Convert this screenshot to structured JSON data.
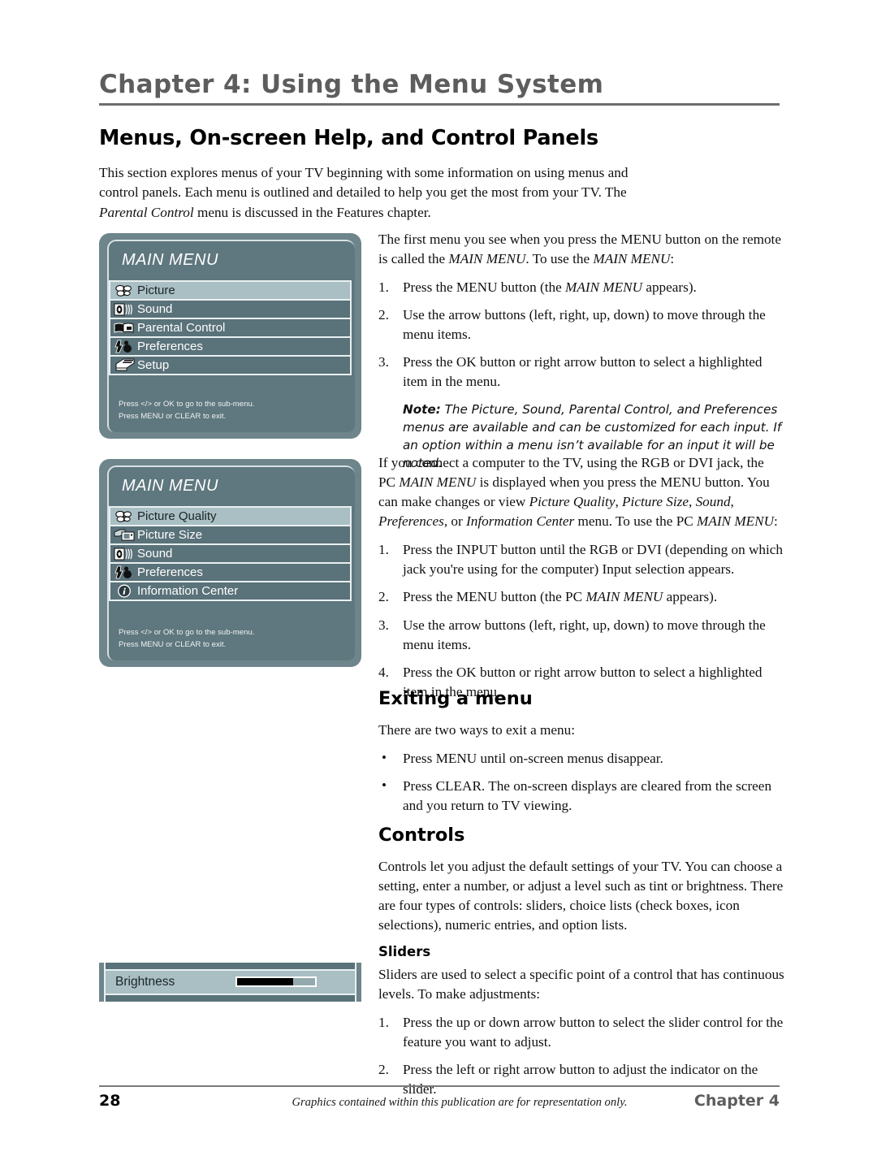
{
  "header": {
    "chapter_title": "Chapter 4: Using the Menu System",
    "main_heading": "Menus, On-screen Help, and Control Panels"
  },
  "intro": {
    "line_a": "This section explores menus of your TV beginning with some information on using menus and control panels. Each menu is outlined and detailed to help you get the most from your TV. The ",
    "emphasis": "Parental Control",
    "line_b": " menu is discussed in the Features chapter."
  },
  "osd_main_menu": {
    "title": "MAIN MENU",
    "items": [
      {
        "label": "Picture",
        "icon": "butterfly-icon",
        "selected": true
      },
      {
        "label": "Sound",
        "icon": "speaker-icon",
        "selected": false
      },
      {
        "label": "Parental Control",
        "icon": "book-icon",
        "selected": false
      },
      {
        "label": "Preferences",
        "icon": "person-icon",
        "selected": false
      },
      {
        "label": "Setup",
        "icon": "toolbox-icon",
        "selected": false
      }
    ],
    "help_line_1": "Press </> or OK to go to the sub-menu.",
    "help_line_2": "Press MENU or CLEAR to exit."
  },
  "osd_pc_main_menu": {
    "title": "MAIN MENU",
    "items": [
      {
        "label": "Picture Quality",
        "icon": "butterfly-icon",
        "selected": true
      },
      {
        "label": "Picture Size",
        "icon": "screen-size-icon",
        "selected": false
      },
      {
        "label": "Sound",
        "icon": "speaker-icon",
        "selected": false
      },
      {
        "label": "Preferences",
        "icon": "person-icon",
        "selected": false
      },
      {
        "label": "Information Center",
        "icon": "info-icon",
        "selected": false
      }
    ],
    "help_line_1": "Press </> or OK to go to the sub-menu.",
    "help_line_2": "Press MENU or CLEAR to exit."
  },
  "osd_slider_panel": {
    "label": "Brightness",
    "fill_percent": 72
  },
  "section_main_menu": {
    "lead_a": "The first menu you see when you press the MENU button on the remote is called the ",
    "lead_em1": "MAIN MENU",
    "lead_b": ". To use the ",
    "lead_em2": "MAIN MENU",
    "lead_c": ":",
    "steps": [
      {
        "num": "1.",
        "a": "Press the MENU button (the ",
        "em": "MAIN MENU",
        "b": " appears)."
      },
      {
        "num": "2.",
        "a": "Use the arrow buttons (left, right, up, down) to move through the menu items.",
        "em": "",
        "b": ""
      },
      {
        "num": "3.",
        "a": "Press the OK button or right arrow button to select a highlighted item in the menu.",
        "em": "",
        "b": ""
      }
    ],
    "note_label": "Note:",
    "note_text": " The Picture, Sound, Parental Control, and Preferences menus are available and can be customized for each input. If an option within a menu isn’t available for an input it will be noted."
  },
  "section_pc_menu": {
    "lead_a": "If you connect a computer to the TV, using the RGB or DVI jack, the PC ",
    "lead_em1": "MAIN MENU",
    "lead_b": " is displayed when you press the MENU button. You can make changes or view ",
    "lead_em2": "Picture Quality",
    "lead_c": ", ",
    "lead_em3": "Picture Size",
    "lead_d": ", ",
    "lead_em4": "Sound",
    "lead_e": ", ",
    "lead_em5": "Preferences",
    "lead_f": ", or ",
    "lead_em6": "Information Center",
    "lead_g": " menu. To use the PC ",
    "lead_em7": "MAIN MENU",
    "lead_h": ":",
    "steps": [
      {
        "num": "1.",
        "a": "Press the INPUT button until the RGB or DVI (depending on which jack you're using for the computer) Input selection appears.",
        "em": "",
        "b": ""
      },
      {
        "num": "2.",
        "a": "Press the MENU button (the PC ",
        "em": "MAIN MENU",
        "b": " appears)."
      },
      {
        "num": "3.",
        "a": "Use the arrow buttons (left, right, up, down) to move through the menu items.",
        "em": "",
        "b": ""
      },
      {
        "num": "4.",
        "a": "Press the OK button or right arrow button to select a highlighted item in the menu.",
        "em": "",
        "b": ""
      }
    ]
  },
  "section_exiting": {
    "heading": "Exiting a menu",
    "lead": "There are two ways to exit a menu:",
    "bullets": [
      "Press MENU until on-screen menus disappear.",
      "Press CLEAR. The on-screen displays are cleared from the screen and you return to TV viewing."
    ]
  },
  "section_controls": {
    "heading": "Controls",
    "body": "Controls let you adjust the default settings of your TV. You can choose a setting, enter a number, or adjust a level such as tint or brightness. There are four types of controls: sliders, choice lists (check boxes, icon selections), numeric entries, and option lists."
  },
  "section_sliders": {
    "heading": "Sliders",
    "body": "Sliders are used to select a specific point of a control that has continuous levels. To make adjustments:",
    "steps": [
      {
        "num": "1.",
        "a": "Press the up or down arrow button to select the slider control for the feature you want to adjust."
      },
      {
        "num": "2.",
        "a": "Press the left or right arrow button to adjust the indicator on the slider."
      }
    ]
  },
  "footer": {
    "page_number": "28",
    "note": "Graphics contained within this publication are for representation only.",
    "chapter": "Chapter 4"
  }
}
